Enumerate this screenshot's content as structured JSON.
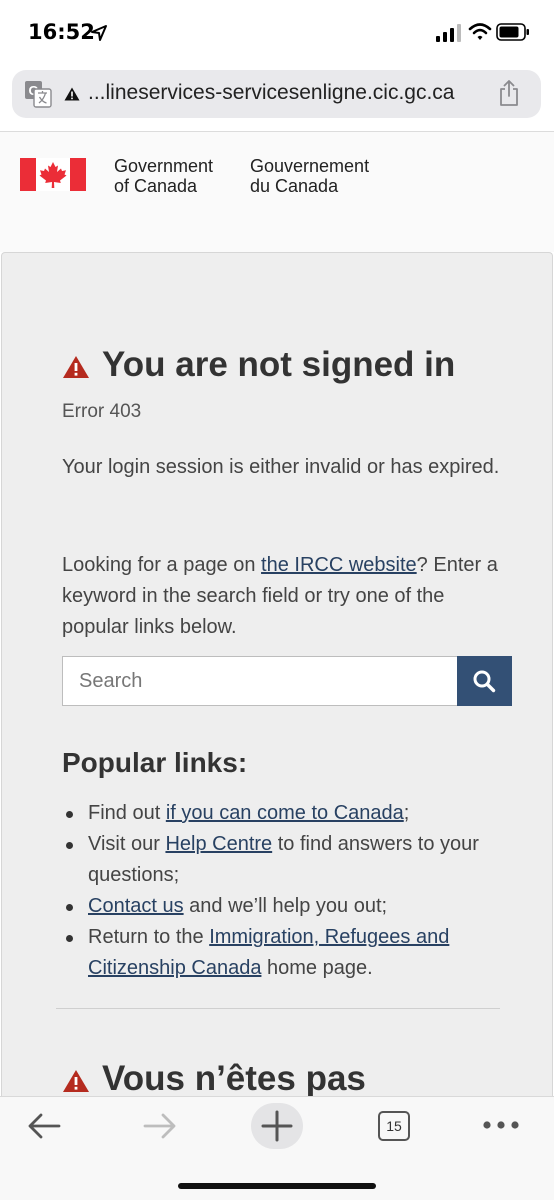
{
  "status_bar": {
    "time": "16:52"
  },
  "url_bar": {
    "url": "...lineservices-servicesenligne.cic.gc.ca"
  },
  "header": {
    "gov_en_line1": "Government",
    "gov_en_line2": "of Canada",
    "gov_fr_line1": "Gouvernement",
    "gov_fr_line2": "du Canada"
  },
  "error": {
    "title": "You are not signed in",
    "code": "Error 403",
    "session_message": "Your login session is either invalid or has expired.",
    "looking_prefix": "Looking for a page on ",
    "ircc_link": "the IRCC website",
    "looking_suffix": "? Enter a keyword in the search field or try one of the popular links below."
  },
  "search": {
    "placeholder": "Search"
  },
  "popular": {
    "heading": "Popular links:",
    "item1_prefix": "Find out ",
    "item1_link": "if you can come to Canada",
    "item1_suffix": ";",
    "item2_prefix": "Visit our ",
    "item2_link": "Help Centre",
    "item2_suffix": " to find answers to your questions;",
    "item3_link": "Contact us",
    "item3_suffix": " and we’ll help you out;",
    "item4_prefix": "Return to the ",
    "item4_link": "Immigration, Refugees and Citizenship Canada",
    "item4_suffix": " home page."
  },
  "error_fr": {
    "title": "Vous n’êtes pas"
  },
  "toolbar": {
    "tab_count": "15"
  },
  "colors": {
    "link": "#284162",
    "search_button": "#335075",
    "warning": "#b52b1f",
    "flag_red": "#eb2d37"
  },
  "icons": {
    "status": [
      "location-arrow-icon",
      "cellular-signal-icon",
      "wifi-icon",
      "battery-icon"
    ],
    "url_bar": [
      "translate-icon",
      "warning-icon",
      "share-icon"
    ],
    "toolbar": [
      "back-arrow-icon",
      "forward-arrow-icon",
      "plus-icon",
      "tab-count-icon",
      "more-icon"
    ]
  }
}
